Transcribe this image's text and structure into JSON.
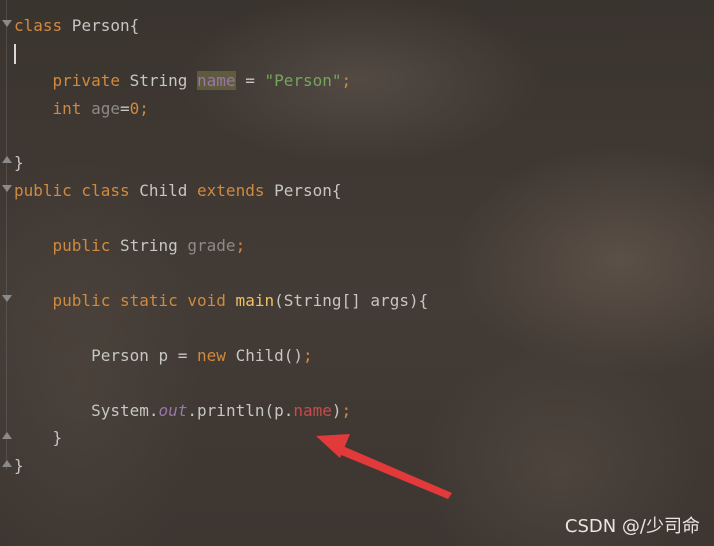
{
  "code": {
    "l1": {
      "kw": "class",
      "rest": " Person{"
    },
    "l2": {
      "kw": "private",
      "type": " String ",
      "field": "name",
      "eq": " = ",
      "str": "\"Person\"",
      "semi": ";"
    },
    "l3": {
      "kw": "int",
      "field": " age",
      "eq": "=",
      "num": "0",
      "semi": ";"
    },
    "l4": {
      "text": "}"
    },
    "l5": {
      "kw1": "public",
      "kw2": " class",
      "name": " Child ",
      "kw3": "extends",
      "rest": " Person{"
    },
    "l6": {
      "kw": "public",
      "type": " String ",
      "field": "grade",
      "semi": ";"
    },
    "l7": {
      "kw": "public static void",
      "fn": " main",
      "rest": "(String[] args){"
    },
    "l8": {
      "type": "Person p = ",
      "kw": "new",
      "rest": " Child()",
      "semi": ";"
    },
    "l9": {
      "pre": "System.",
      "out": "out",
      "mid": ".println(p.",
      "err": "name",
      "post": ")",
      "semi": ";"
    },
    "l10": {
      "text": "}"
    },
    "l11": {
      "text": "}"
    }
  },
  "watermark": "CSDN @/少司命",
  "colors": {
    "keyword": "#d08a3f",
    "string": "#77a55c",
    "error_ref": "#c84b4b",
    "arrow": "#e23a3a"
  }
}
